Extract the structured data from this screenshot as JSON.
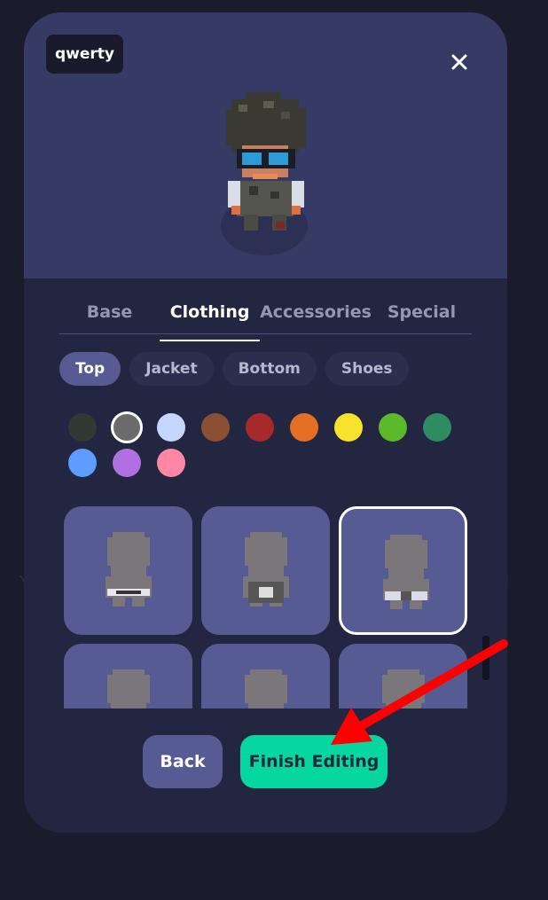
{
  "player": {
    "name": "qwerty"
  },
  "background": {
    "left_fragment": "Y",
    "right_fragment": "!"
  },
  "tabs": [
    {
      "label": "Base",
      "active": false
    },
    {
      "label": "Clothing",
      "active": true
    },
    {
      "label": "Accessories",
      "active": false
    },
    {
      "label": "Special",
      "active": false
    }
  ],
  "subtabs": [
    {
      "label": "Top",
      "active": true
    },
    {
      "label": "Jacket",
      "active": false
    },
    {
      "label": "Bottom",
      "active": false
    },
    {
      "label": "Shoes",
      "active": false
    }
  ],
  "colors": {
    "selected_index": 1,
    "swatches": [
      "#2e3a32",
      "#6b6b6b",
      "#c7d6ff",
      "#8b4f34",
      "#a62a2a",
      "#e46e22",
      "#f7e32c",
      "#5cba2a",
      "#2f8c62",
      "#5e9cff",
      "#b070e2",
      "#ff86a5"
    ]
  },
  "clothing_items": {
    "selected_index": 2,
    "count_visible": 6
  },
  "buttons": {
    "back": "Back",
    "finish": "Finish Editing"
  },
  "icons": {
    "close": "close-icon"
  },
  "accent": {
    "finish": "#06d6a0",
    "chip": "#565c93",
    "annotation_arrow": "#ff0000"
  }
}
